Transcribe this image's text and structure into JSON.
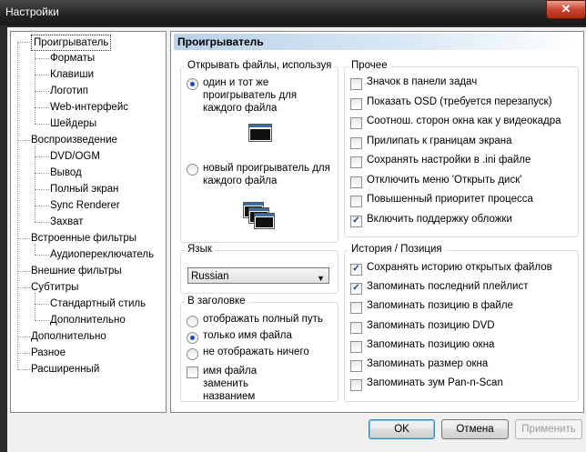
{
  "window": {
    "title": "Настройки",
    "close": "✕"
  },
  "tree": [
    {
      "label": "Проигрыватель",
      "level": 0,
      "selected": true
    },
    {
      "label": "Форматы",
      "level": 1
    },
    {
      "label": "Клавиши",
      "level": 1
    },
    {
      "label": "Логотип",
      "level": 1
    },
    {
      "label": "Web-интерфейс",
      "level": 1
    },
    {
      "label": "Шейдеры",
      "level": 1
    },
    {
      "label": "Воспроизведение",
      "level": 0
    },
    {
      "label": "DVD/OGM",
      "level": 1
    },
    {
      "label": "Вывод",
      "level": 1
    },
    {
      "label": "Полный экран",
      "level": 1
    },
    {
      "label": "Sync Renderer",
      "level": 1
    },
    {
      "label": "Захват",
      "level": 1
    },
    {
      "label": "Встроенные фильтры",
      "level": 0
    },
    {
      "label": "Аудиопереключатель",
      "level": 1
    },
    {
      "label": "Внешние фильтры",
      "level": 0
    },
    {
      "label": "Субтитры",
      "level": 0
    },
    {
      "label": "Стандартный стиль",
      "level": 1
    },
    {
      "label": "Дополнительно",
      "level": 1
    },
    {
      "label": "Дополнительно",
      "level": 0
    },
    {
      "label": "Разное",
      "level": 0
    },
    {
      "label": "Расширенный",
      "level": 0
    }
  ],
  "panel": {
    "title": "Проигрыватель",
    "open_group": {
      "label": "Открывать файлы, используя",
      "options": [
        {
          "label": "один и тот же проигрыватель для каждого файла",
          "checked": true,
          "icon": "single-window-icon"
        },
        {
          "label": "новый проигрыватель для каждого файла",
          "checked": false,
          "icon": "multi-window-icon"
        }
      ]
    },
    "misc_group": {
      "label": "Прочее",
      "items": [
        {
          "label": "Значок в панели задач",
          "checked": false
        },
        {
          "label": "Показать OSD (требуется перезапуск)",
          "checked": false
        },
        {
          "label": "Соотнош. сторон окна как у видеокадра",
          "checked": false
        },
        {
          "label": "Прилипать к границам экрана",
          "checked": false
        },
        {
          "label": "Сохранять настройки в .ini файле",
          "checked": false
        },
        {
          "label": "Отключить меню 'Открыть диск'",
          "checked": false
        },
        {
          "label": "Повышенный приоритет процесса",
          "checked": false
        },
        {
          "label": "Включить поддержку обложки",
          "checked": true
        }
      ]
    },
    "lang_group": {
      "label": "Язык",
      "value": "Russian"
    },
    "title_group": {
      "label": "В заголовке",
      "options": [
        {
          "label": "отображать полный путь",
          "checked": false
        },
        {
          "label": "только имя файла",
          "checked": true
        },
        {
          "label": "не отображать ничего",
          "checked": false
        }
      ],
      "replace": {
        "label": "имя файла заменить названием",
        "checked": false
      }
    },
    "history_group": {
      "label": "История / Позиция",
      "items": [
        {
          "label": "Сохранять историю открытых файлов",
          "checked": true
        },
        {
          "label": "Запоминать последний плейлист",
          "checked": true
        },
        {
          "label": "Запоминать позицию в файле",
          "checked": false
        },
        {
          "label": "Запоминать позицию DVD",
          "checked": false
        },
        {
          "label": "Запоминать позицию окна",
          "checked": false
        },
        {
          "label": "Запоминать размер окна",
          "checked": false
        },
        {
          "label": "Запоминать зум Pan-n-Scan",
          "checked": false
        }
      ]
    }
  },
  "buttons": {
    "ok": "OK",
    "cancel": "Отмена",
    "apply": "Применить"
  },
  "colors": {
    "accent": "#3c7fb1",
    "header_gradient": "#b9d1ea",
    "check": "#1c3b8c"
  }
}
